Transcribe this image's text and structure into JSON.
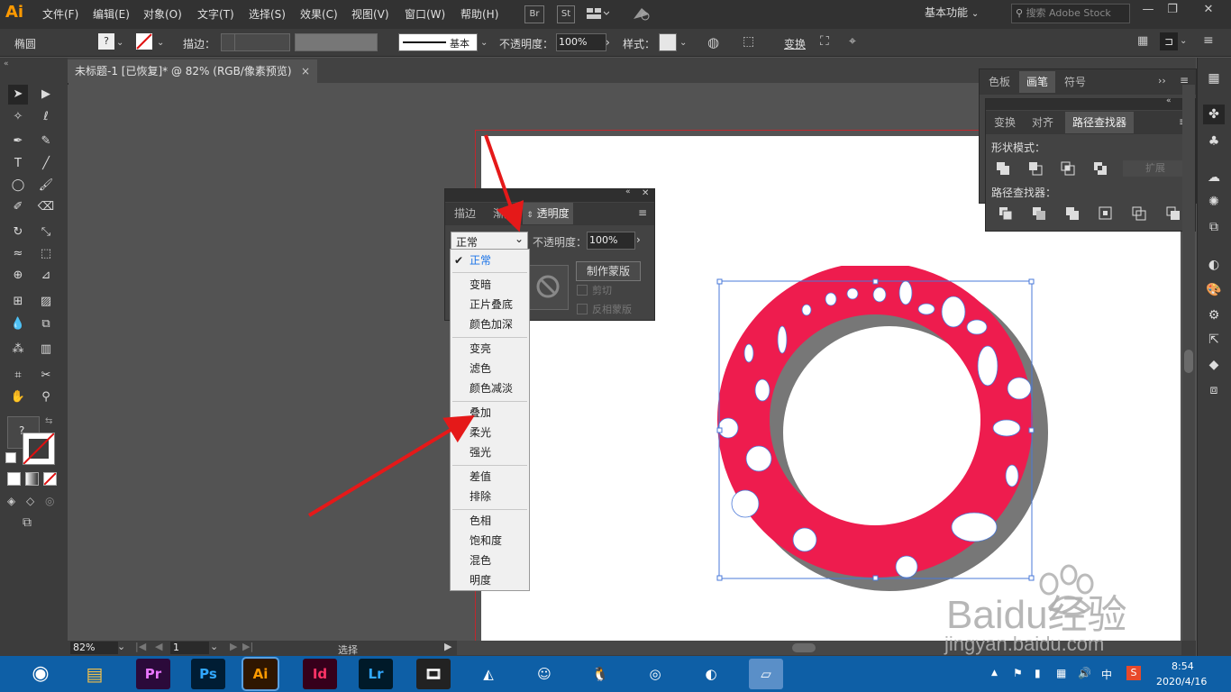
{
  "app": {
    "logo": "Ai",
    "menu": [
      "文件(F)",
      "编辑(E)",
      "对象(O)",
      "文字(T)",
      "选择(S)",
      "效果(C)",
      "视图(V)",
      "窗口(W)",
      "帮助(H)"
    ],
    "bridge_label": "Br",
    "stock_label": "St",
    "workspace": "基本功能",
    "search_placeholder": "搜索 Adobe Stock"
  },
  "control_bar": {
    "object_type": "椭圆",
    "stroke_label": "描边：",
    "stroke_profile": "基本",
    "opacity_label": "不透明度：",
    "opacity_value": "100%",
    "style_label": "样式：",
    "transform_label": "变换"
  },
  "document": {
    "tab_title": "未标题-1 [已恢复]* @ 82% (RGB/像素预览)",
    "close_glyph": "×"
  },
  "transparency_panel": {
    "tabs": [
      "描边",
      "渐变",
      "透明度"
    ],
    "active_tab": "透明度",
    "blend_mode": "正常",
    "opacity_label": "不透明度：",
    "opacity_value": "100%",
    "make_mask_button": "制作蒙版",
    "clip_label": "剪切",
    "invert_mask_label": "反相蒙版",
    "blend_modes": [
      [
        "正常"
      ],
      [
        "变暗",
        "正片叠底",
        "颜色加深"
      ],
      [
        "变亮",
        "滤色",
        "颜色减淡"
      ],
      [
        "叠加",
        "柔光",
        "强光"
      ],
      [
        "差值",
        "排除"
      ],
      [
        "色相",
        "饱和度",
        "混色",
        "明度"
      ]
    ],
    "selected_mode": "正常",
    "selected_color": "#1a73e8"
  },
  "top_panel": {
    "tabs": [
      "色板",
      "画笔",
      "符号"
    ],
    "active_tab": "画笔"
  },
  "pathfinder_panel": {
    "tabs": [
      "变换",
      "对齐",
      "路径查找器"
    ],
    "active_tab": "路径查找器",
    "shape_modes_label": "形状模式：",
    "expand_button": "扩展",
    "pathfinders_label": "路径查找器："
  },
  "status_bar": {
    "zoom": "82%",
    "artboard_number": "1",
    "tool_status": "选择"
  },
  "taskbar": {
    "apps": [
      "Pr",
      "Ps",
      "Ai",
      "Id",
      "Lr"
    ],
    "app_colors": {
      "Pr": "#ea77ff",
      "Ps": "#31a8ff",
      "Ai": "#ff9a00",
      "Id": "#ff3366",
      "Lr": "#31a8ff"
    },
    "time": "8:54",
    "date": "2020/4/16",
    "ime": "中"
  },
  "watermark": {
    "brand": "Baidu经验",
    "url": "jingyan.baidu.com"
  },
  "colors": {
    "ring_fill": "#ee1c4e",
    "selection": "#4a78d8",
    "arrow": "#e51919"
  }
}
